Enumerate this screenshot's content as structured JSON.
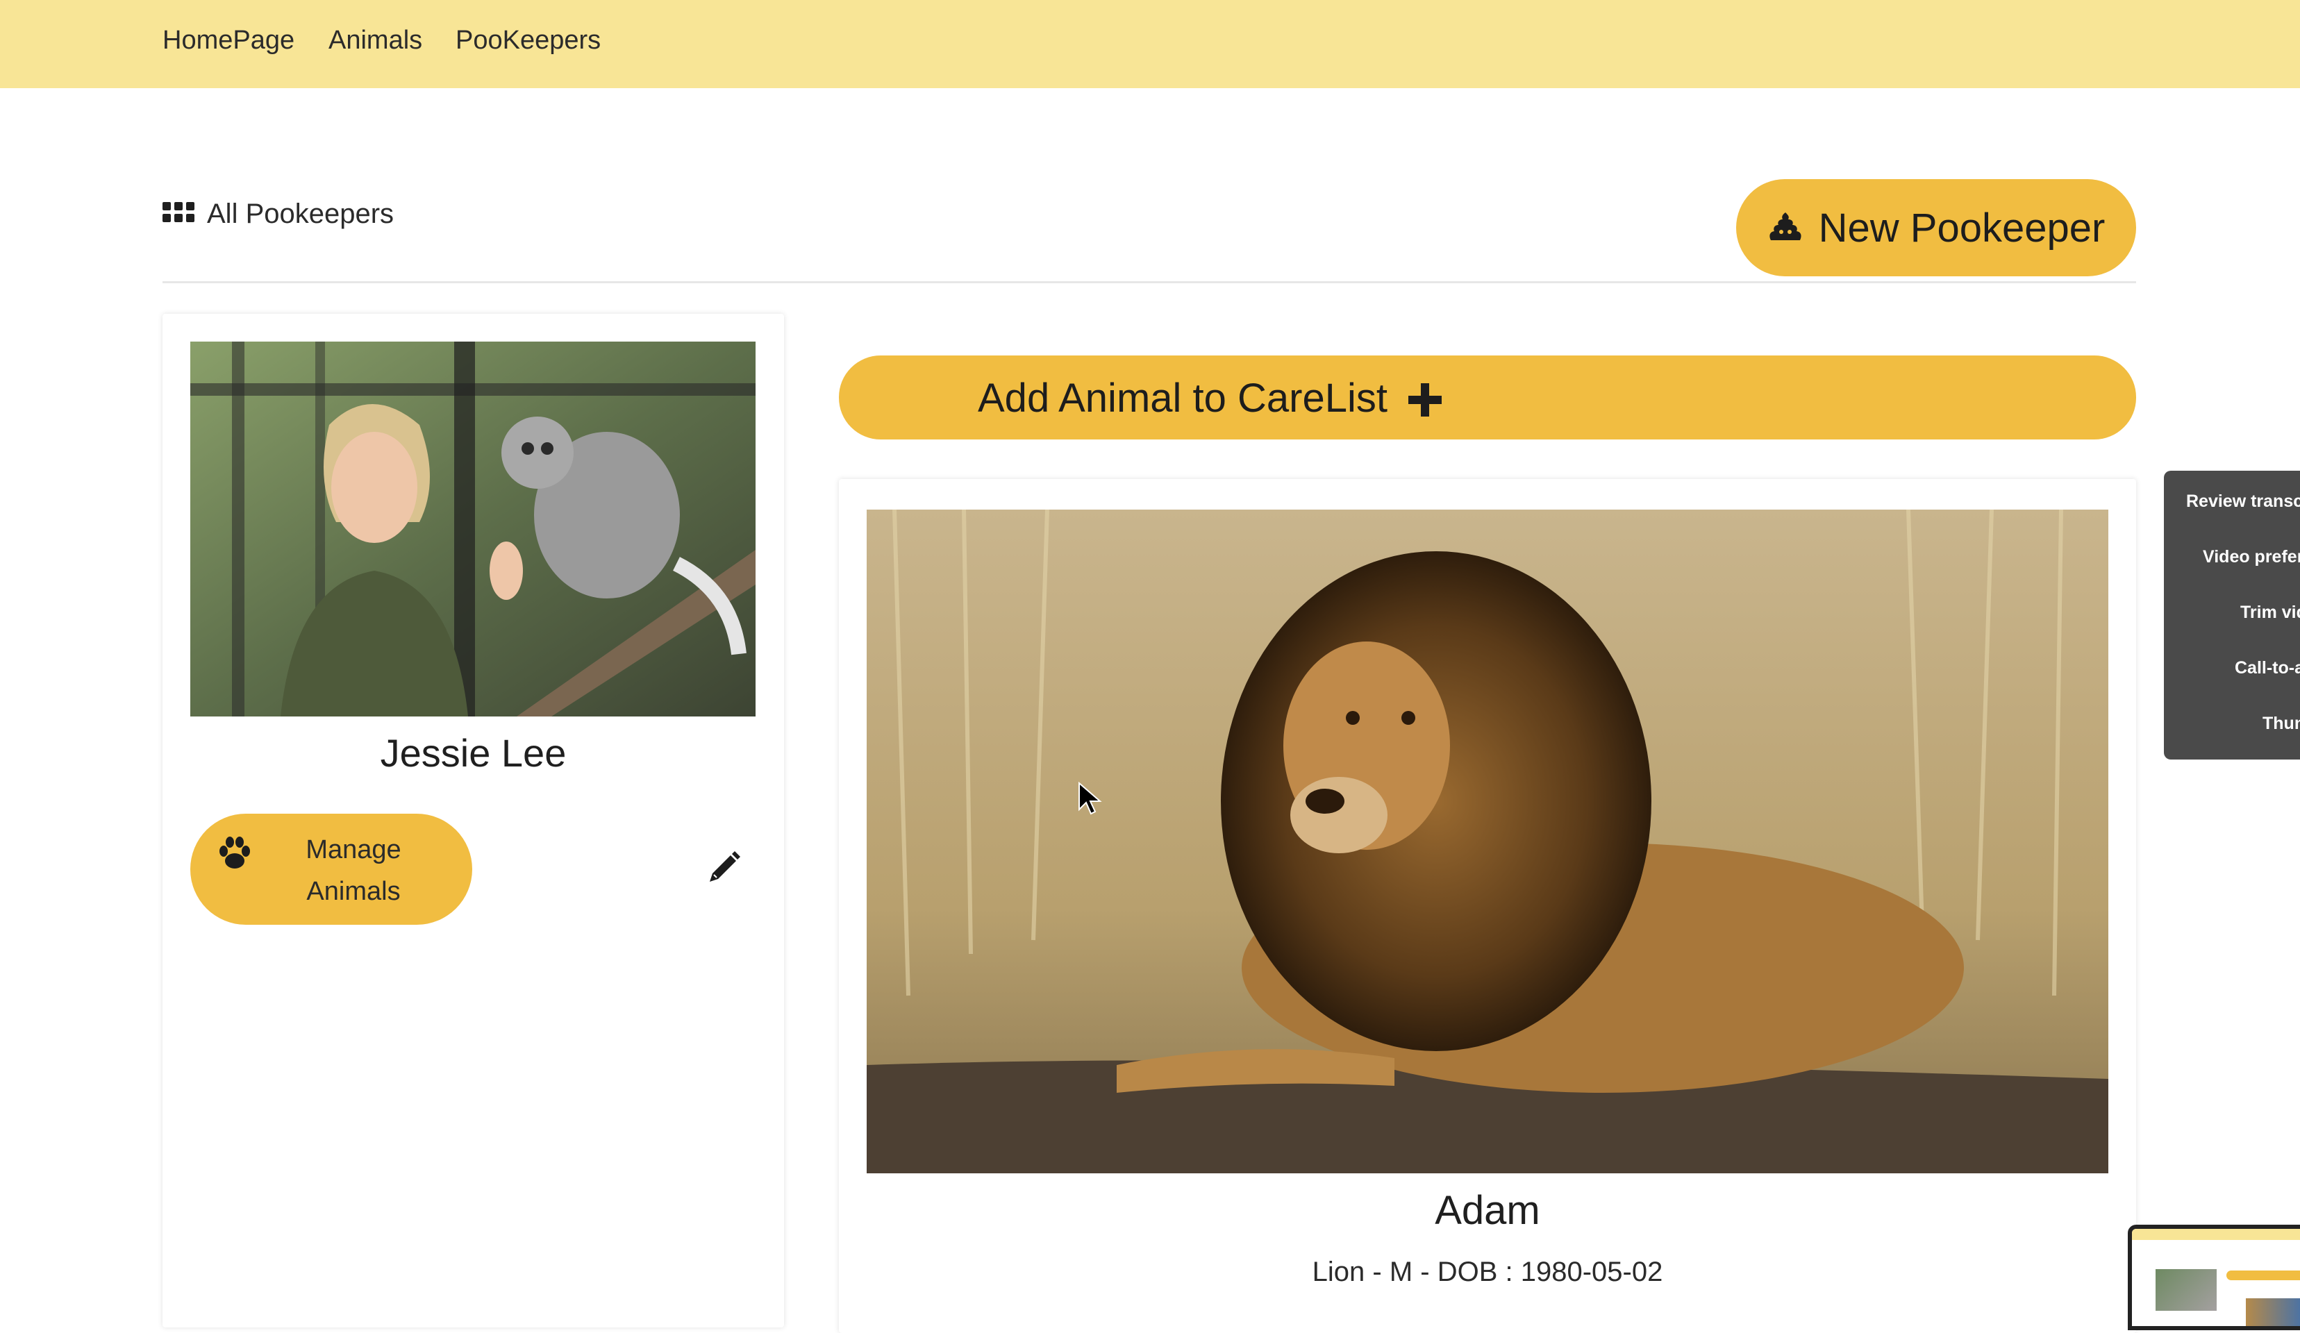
{
  "nav": {
    "links": [
      "HomePage",
      "Animals",
      "PooKeepers"
    ]
  },
  "header": {
    "all_pookeepers_label": "All Pookeepers",
    "new_pookeeper_label": "New Pookeeper"
  },
  "keeper": {
    "name": "Jessie Lee",
    "manage_label": "Manage Animals"
  },
  "carelist": {
    "add_label": "Add Animal to CareList",
    "animal": {
      "name": "Adam",
      "meta": "Lion - M - DOB : 1980-05-02"
    }
  },
  "side_menu": {
    "items": [
      "Review transcr",
      "Video prefer",
      "Trim vid",
      "Call-to-a",
      "Thun"
    ]
  },
  "colors": {
    "navbar": "#f8e596",
    "accent": "#f1bd41",
    "menu_bg": "#4a4a4a"
  },
  "icons": [
    "grid-icon",
    "poop-icon",
    "paw-icon",
    "pencil-icon",
    "plus-icon",
    "cursor-icon"
  ]
}
